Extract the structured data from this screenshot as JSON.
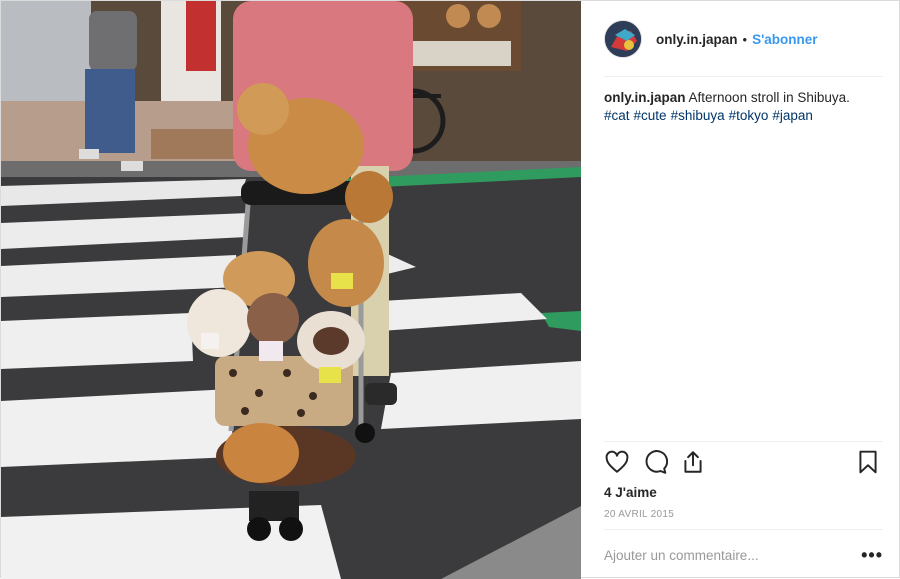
{
  "post": {
    "username": "only.in.japan",
    "separator": "•",
    "follow_label": "S'abonner",
    "caption_username": "only.in.japan",
    "caption_text": "Afternoon stroll in Shibuya.",
    "hashtags": [
      "#cat",
      "#cute",
      "#shibuya",
      "#tokyo",
      "#japan"
    ],
    "likes": "4 J'aime",
    "date": "20 AVRIL 2015",
    "comment_placeholder": "Ajouter un commentaire...",
    "more_label": "•••"
  },
  "colors": {
    "accent": "#3897f0",
    "hashtag": "#003569",
    "muted": "#999999"
  },
  "icons": [
    "heart-icon",
    "comment-icon",
    "share-icon",
    "bookmark-icon",
    "more-options-icon"
  ]
}
